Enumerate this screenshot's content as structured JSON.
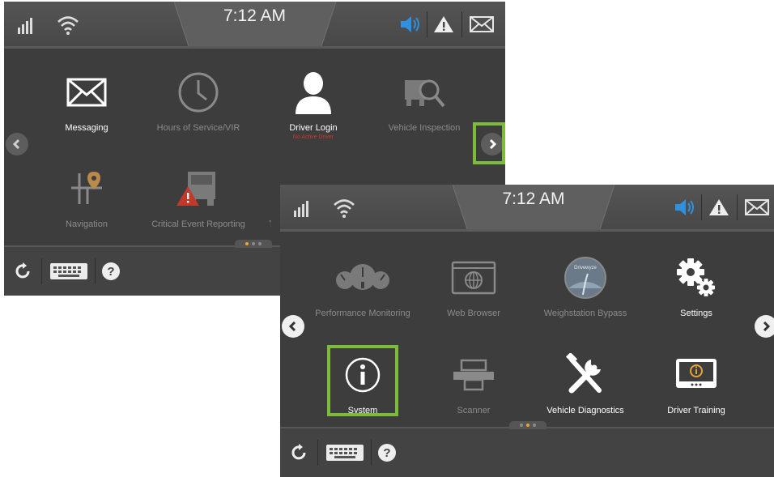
{
  "colors": {
    "accent_green": "#7dbb3a",
    "speaker_blue": "#2f8fe0",
    "alert_red": "#d7352b",
    "pager_active": "#f2a32a"
  },
  "screen1": {
    "time": "7:12 AM",
    "status_icons": [
      "signal-icon",
      "wifi-icon",
      "speaker-icon",
      "warning-icon",
      "mail-icon"
    ],
    "apps": [
      {
        "label": "Messaging",
        "icon": "envelope-icon",
        "active": true
      },
      {
        "label": "Hours of Service/VIR",
        "icon": "clock-icon",
        "active": false
      },
      {
        "label": "Driver Login",
        "sub": "No Active Driver",
        "icon": "person-icon",
        "active": true
      },
      {
        "label": "Vehicle Inspection",
        "icon": "truck-magnifier-icon",
        "active": false
      },
      {
        "label": "Navigation",
        "icon": "map-pin-icon",
        "active": false
      },
      {
        "label": "Critical Event Reporting",
        "icon": "truck-warning-icon",
        "active": false
      },
      {
        "label": "Tra",
        "icon": "partial-icon",
        "active": false
      }
    ],
    "page_indicator": {
      "pages": 3,
      "current": 1
    }
  },
  "screen2": {
    "time": "7:12 AM",
    "status_icons": [
      "signal-icon",
      "wifi-icon",
      "speaker-icon",
      "warning-icon",
      "mail-icon"
    ],
    "apps": [
      {
        "label": "Performance Monitoring",
        "icon": "gauges-icon",
        "active": false
      },
      {
        "label": "Web Browser",
        "icon": "browser-icon",
        "active": false
      },
      {
        "label": "Weighstation Bypass",
        "badge": "Drivewyze",
        "icon": "drivewyze-icon",
        "active": false
      },
      {
        "label": "Settings",
        "icon": "gears-icon",
        "active": true
      },
      {
        "label": "System",
        "icon": "info-icon",
        "active": true
      },
      {
        "label": "Scanner",
        "icon": "scanner-icon",
        "active": false
      },
      {
        "label": "Vehicle Diagnostics",
        "icon": "tools-icon",
        "active": true
      },
      {
        "label": "Driver Training",
        "icon": "training-monitor-icon",
        "active": true
      }
    ],
    "page_indicator": {
      "pages": 3,
      "current": 2
    }
  }
}
